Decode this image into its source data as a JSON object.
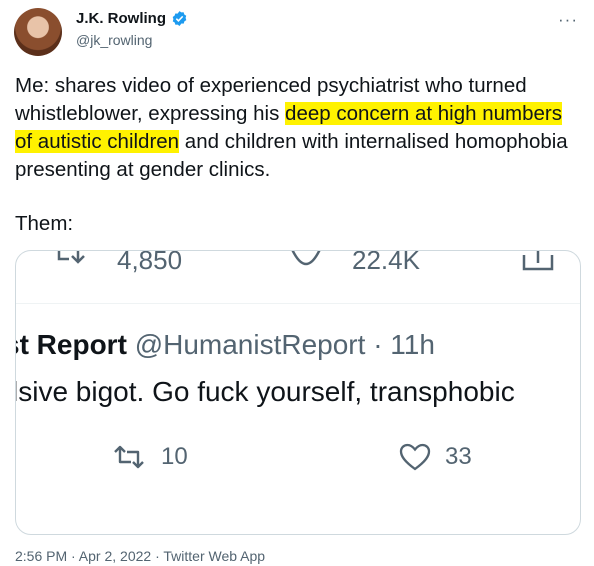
{
  "author": {
    "name": "J.K. Rowling",
    "handle": "@jk_rowling",
    "verified": true
  },
  "more_label": "···",
  "tweet": {
    "text_a": "Me: shares video of experienced psychiatrist who turned whistleblower, expressing his ",
    "highlight": "deep concern at high numbers of autistic children",
    "text_b": " and children with internalised homophobia presenting at gender clinics.",
    "them": "Them:"
  },
  "embed": {
    "top_counts": {
      "retweets": "4,850",
      "likes": "22.4K"
    },
    "reply": {
      "display_name": "st Report",
      "handle_time": "@HumanistReport · 11h",
      "text": "lsive bigot. Go fuck yourself, transphobic",
      "retweets": "10",
      "likes": "33"
    }
  },
  "timestamp": "2:56 PM · Apr 2, 2022 · Twitter Web App",
  "colors": {
    "verified": "#1d9bf0",
    "highlight": "#fff200",
    "muted": "#536471"
  }
}
